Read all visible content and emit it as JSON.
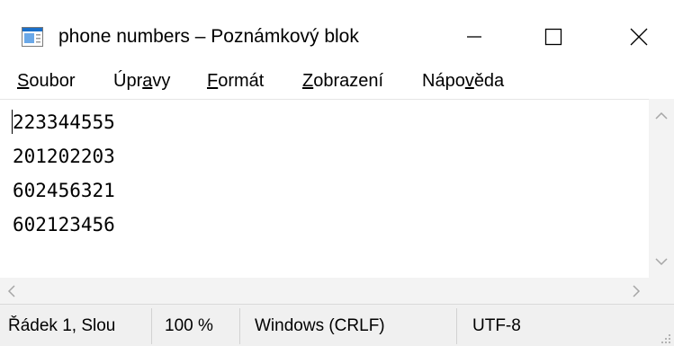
{
  "window": {
    "title": "phone numbers – Poznámkový blok",
    "icon": "notepad-icon",
    "controls": [
      "minimize-icon",
      "maximize-icon",
      "close-icon"
    ]
  },
  "menu": [
    {
      "accel": "S",
      "rest": "oubor"
    },
    {
      "pre": "Úpr",
      "accel": "a",
      "rest": "vy"
    },
    {
      "accel": "F",
      "rest": "ormát"
    },
    {
      "accel": "Z",
      "rest": "obrazení"
    },
    {
      "pre": "Nápo",
      "accel": "v",
      "rest": "ěda"
    }
  ],
  "editor": {
    "lines": [
      "223344555",
      "201202203",
      "602456321",
      "602123456"
    ]
  },
  "status": {
    "position": "Řádek 1, Slou",
    "zoom": "100 %",
    "line_ending": "Windows (CRLF)",
    "encoding": "UTF-8"
  },
  "colors": {
    "background": "#ffffff",
    "statusbar": "#f0f0f0",
    "scrollbar": "#f3f3f3",
    "icon_blue": "#1a6fc9"
  }
}
